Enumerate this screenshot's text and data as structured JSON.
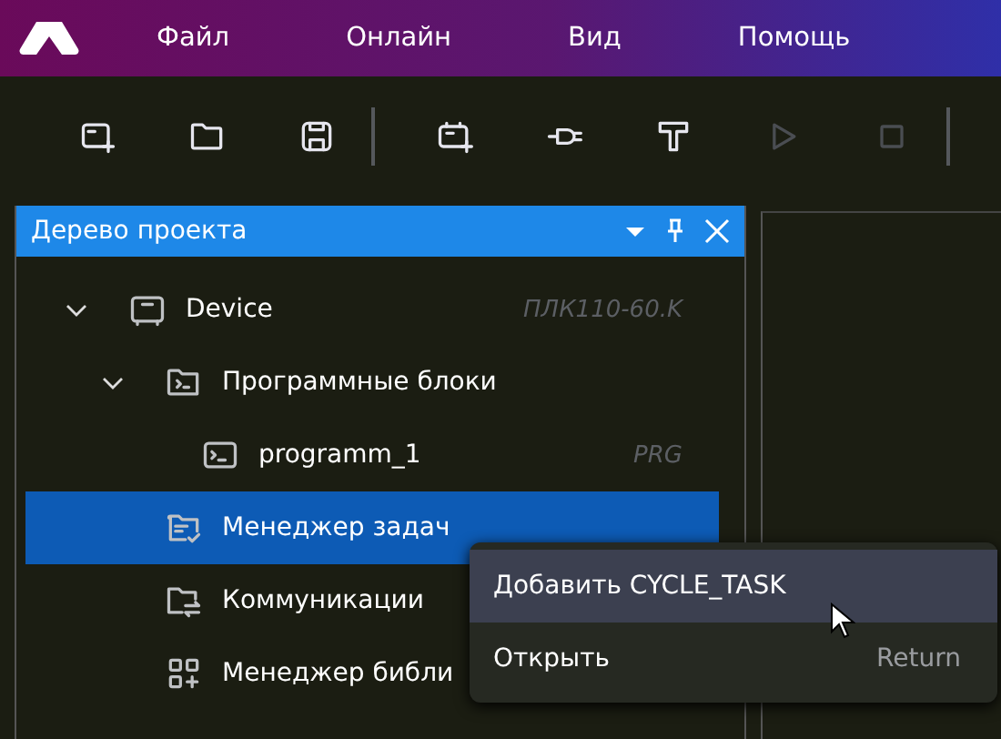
{
  "menu": [
    "Файл",
    "Онлайн",
    "Вид",
    "Помощь"
  ],
  "toolbar": [
    {
      "kind": "new",
      "disabled": false
    },
    {
      "kind": "open",
      "disabled": false
    },
    {
      "kind": "save",
      "disabled": false
    },
    {
      "kind": "separator"
    },
    {
      "kind": "add-device",
      "disabled": false
    },
    {
      "kind": "connect",
      "disabled": false
    },
    {
      "kind": "build",
      "disabled": false
    },
    {
      "kind": "run",
      "disabled": true
    },
    {
      "kind": "stop",
      "disabled": true
    },
    {
      "kind": "separator"
    }
  ],
  "panel": {
    "title": "Дерево проекта"
  },
  "tree": [
    {
      "label": "Device",
      "kind": "device",
      "type": "ПЛК110-60.K",
      "selected": false,
      "expanded": true,
      "children": [
        {
          "label": "Программные блоки",
          "kind": "folder",
          "selected": false,
          "expanded": true,
          "children": [
            {
              "label": "programm_1",
              "kind": "program",
              "type": "PRG",
              "selected": false
            }
          ]
        },
        {
          "label": "Менеджер задач",
          "kind": "tasks",
          "selected": true
        },
        {
          "label": "Коммуникации",
          "kind": "comms",
          "selected": false
        },
        {
          "label": "Менеджер библи",
          "kind": "library",
          "selected": false
        }
      ]
    }
  ],
  "context_menu": [
    {
      "label": "Добавить CYCLE_TASK",
      "selected": true
    },
    {
      "label": "Открыть",
      "shortcut": "Return",
      "selected": false
    }
  ]
}
